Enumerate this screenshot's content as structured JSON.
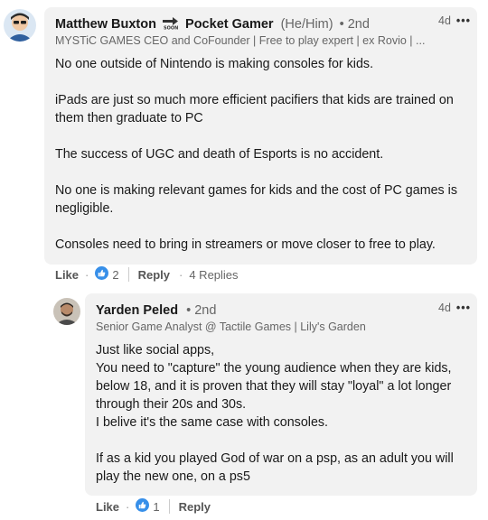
{
  "comment": {
    "author_name": "Matthew Buxton",
    "author_company": "Pocket Gamer",
    "pronouns": "(He/Him)",
    "degree": "• 2nd",
    "headline": "MYSTiC GAMES CEO and CoFounder | Free to play expert | ex Rovio | ...",
    "time": "4d",
    "more": "•••",
    "paragraphs": [
      "No one outside of Nintendo is making consoles for kids.",
      "iPads are just so much more efficient pacifiers that kids are trained on them then graduate to PC",
      "The success of UGC and death of Esports is no accident.",
      "No one is making relevant games for kids and the cost of PC games is negligible.",
      "Consoles need to bring in streamers or move closer to free to play."
    ],
    "actions": {
      "like": "Like",
      "dot": "·",
      "like_count": "2",
      "reply": "Reply",
      "replies": "4 Replies"
    }
  },
  "reply": {
    "author_name": "Yarden Peled",
    "degree": "• 2nd",
    "headline": "Senior Game Analyst @ Tactile Games | Lily's Garden",
    "time": "4d",
    "more": "•••",
    "lines": [
      "Just like social apps,",
      "You need to \"capture\" the young audience when they are kids, below 18, and it is proven that they will stay \"loyal\" a lot longer through their 20s and 30s.",
      "I belive it's the same case with consoles."
    ],
    "paragraph2": "If as a kid you played God of war on a psp, as an adult you will play the new one, on a ps5",
    "actions": {
      "like": "Like",
      "dot": "·",
      "like_count": "1",
      "reply": "Reply"
    }
  },
  "colors": {
    "bubble": "#f2f2f2",
    "like_blue": "#378fe9",
    "text": "#191919",
    "muted": "#666666"
  },
  "icons": {
    "soon_arrow": "soon-arrow-icon",
    "like": "thumbs-up-icon",
    "more": "more-horizontal-icon"
  }
}
